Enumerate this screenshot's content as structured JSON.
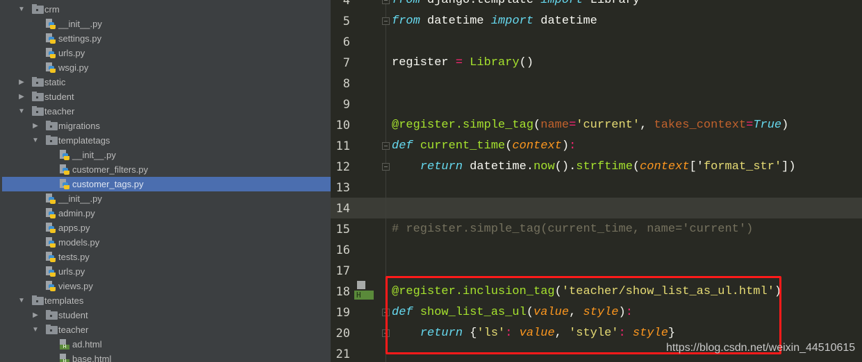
{
  "project_tree": [
    {
      "label": "crm",
      "type": "folder",
      "level": 1,
      "expanded": true
    },
    {
      "label": "__init__.py",
      "type": "py",
      "level": 2
    },
    {
      "label": "settings.py",
      "type": "py",
      "level": 2
    },
    {
      "label": "urls.py",
      "type": "py",
      "level": 2
    },
    {
      "label": "wsgi.py",
      "type": "py",
      "level": 2
    },
    {
      "label": "static",
      "type": "folder",
      "level": 1,
      "expanded": false
    },
    {
      "label": "student",
      "type": "folder",
      "level": 1,
      "expanded": false
    },
    {
      "label": "teacher",
      "type": "folder",
      "level": 1,
      "expanded": true
    },
    {
      "label": "migrations",
      "type": "folder",
      "level": 2,
      "expanded": false
    },
    {
      "label": "templatetags",
      "type": "folder",
      "level": 2,
      "expanded": true
    },
    {
      "label": "__init__.py",
      "type": "py",
      "level": 3
    },
    {
      "label": "customer_filters.py",
      "type": "py",
      "level": 3
    },
    {
      "label": "customer_tags.py",
      "type": "py",
      "level": 3,
      "selected": true
    },
    {
      "label": "__init__.py",
      "type": "py",
      "level": 2
    },
    {
      "label": "admin.py",
      "type": "py",
      "level": 2
    },
    {
      "label": "apps.py",
      "type": "py",
      "level": 2
    },
    {
      "label": "models.py",
      "type": "py",
      "level": 2
    },
    {
      "label": "tests.py",
      "type": "py",
      "level": 2
    },
    {
      "label": "urls.py",
      "type": "py",
      "level": 2
    },
    {
      "label": "views.py",
      "type": "py",
      "level": 2
    },
    {
      "label": "templates",
      "type": "folder",
      "level": 1,
      "expanded": true
    },
    {
      "label": "student",
      "type": "folder",
      "level": 2,
      "expanded": false
    },
    {
      "label": "teacher",
      "type": "folder",
      "level": 2,
      "expanded": true
    },
    {
      "label": "ad.html",
      "type": "html",
      "level": 3
    },
    {
      "label": "base.html",
      "type": "html",
      "level": 3
    }
  ],
  "editor": {
    "current_line": 14,
    "highlight_box_lines": [
      18,
      20
    ],
    "lines": [
      {
        "n": "4",
        "fold": true,
        "tokens": [
          [
            "from",
            "k"
          ],
          [
            " django.template ",
            "w"
          ],
          [
            "import",
            "k"
          ],
          [
            " Library",
            "w"
          ]
        ]
      },
      {
        "n": "5",
        "fold": true,
        "tokens": [
          [
            "from",
            "k"
          ],
          [
            " datetime ",
            "w"
          ],
          [
            "import",
            "k"
          ],
          [
            " datetime",
            "w"
          ]
        ]
      },
      {
        "n": "6",
        "tokens": []
      },
      {
        "n": "7",
        "tokens": [
          [
            "register ",
            "w"
          ],
          [
            "=",
            "o"
          ],
          [
            " ",
            "w"
          ],
          [
            "Library",
            "f"
          ],
          [
            "()",
            "w"
          ]
        ]
      },
      {
        "n": "8",
        "tokens": []
      },
      {
        "n": "9",
        "tokens": []
      },
      {
        "n": "10",
        "tokens": [
          [
            "@register.simple_tag",
            "f"
          ],
          [
            "(",
            "w"
          ],
          [
            "name",
            "kw"
          ],
          [
            "=",
            "o"
          ],
          [
            "'current'",
            "s"
          ],
          [
            ", ",
            "w"
          ],
          [
            "takes_context",
            "kw"
          ],
          [
            "=",
            "o"
          ],
          [
            "True",
            "k"
          ],
          [
            ")",
            "w"
          ]
        ]
      },
      {
        "n": "11",
        "fold": true,
        "tokens": [
          [
            "def",
            "k"
          ],
          [
            " ",
            "w"
          ],
          [
            "current_time",
            "f"
          ],
          [
            "(",
            "w"
          ],
          [
            "context",
            "p"
          ],
          [
            ")",
            "w"
          ],
          [
            ":",
            "o"
          ]
        ]
      },
      {
        "n": "12",
        "fold": true,
        "tokens": [
          [
            "    ",
            "w"
          ],
          [
            "return",
            "k"
          ],
          [
            " datetime.",
            "w"
          ],
          [
            "now",
            "f"
          ],
          [
            "().",
            "w"
          ],
          [
            "strftime",
            "f"
          ],
          [
            "(",
            "w"
          ],
          [
            "context",
            "p"
          ],
          [
            "['",
            "w"
          ],
          [
            "format_str'",
            "s"
          ],
          [
            "])",
            "w"
          ]
        ]
      },
      {
        "n": "13",
        "tokens": []
      },
      {
        "n": "14",
        "tokens": []
      },
      {
        "n": "15",
        "tokens": [
          [
            "# register.simple_tag(current_time, name='current')",
            "c"
          ]
        ]
      },
      {
        "n": "16",
        "tokens": []
      },
      {
        "n": "17",
        "tokens": []
      },
      {
        "n": "18",
        "tokens": [
          [
            "@register.inclusion_tag",
            "f"
          ],
          [
            "(",
            "w"
          ],
          [
            "'teacher/show_list_as_ul.html'",
            "s"
          ],
          [
            ")",
            "w"
          ]
        ]
      },
      {
        "n": "19",
        "fold": true,
        "tokens": [
          [
            "def",
            "k"
          ],
          [
            " ",
            "w"
          ],
          [
            "show_list_as_ul",
            "f"
          ],
          [
            "(",
            "w"
          ],
          [
            "value",
            "p"
          ],
          [
            ", ",
            "w"
          ],
          [
            "style",
            "p"
          ],
          [
            ")",
            "w"
          ],
          [
            ":",
            "o"
          ]
        ]
      },
      {
        "n": "20",
        "fold": true,
        "tokens": [
          [
            "    ",
            "w"
          ],
          [
            "return",
            "k"
          ],
          [
            " {",
            "w"
          ],
          [
            "'ls'",
            "s"
          ],
          [
            ": ",
            "o"
          ],
          [
            "value",
            "p"
          ],
          [
            ", ",
            "w"
          ],
          [
            "'style'",
            "s"
          ],
          [
            ": ",
            "o"
          ],
          [
            "style",
            "p"
          ],
          [
            "}",
            "w"
          ]
        ]
      },
      {
        "n": "21",
        "tokens": []
      }
    ]
  },
  "gutter_icon": "html-template-marker-icon",
  "gutter_icon_letter": "H",
  "watermark": "https://blog.csdn.net/weixin_44510615",
  "colors": {
    "selection": "#4b6eaf",
    "highlight_box": "#ff1a1a",
    "editor_bg": "#282923",
    "sidebar_bg": "#3c3f41"
  }
}
